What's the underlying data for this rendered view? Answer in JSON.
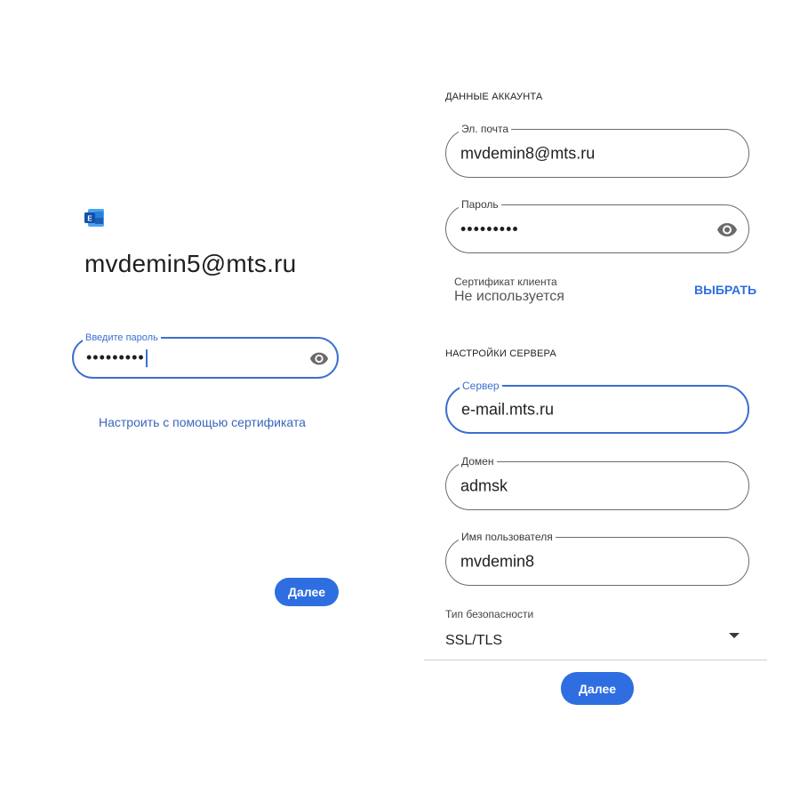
{
  "left": {
    "account_email": "mvdemin5@mts.ru",
    "password_field": {
      "label": "Введите пароль",
      "masked_value": "•••••••••"
    },
    "certificate_link": "Настроить с помощью сертификата",
    "next_button": "Далее"
  },
  "right": {
    "account_section": "ДАННЫЕ АККАУНТА",
    "email_field": {
      "label": "Эл. почта",
      "value": "mvdemin8@mts.ru"
    },
    "password_field": {
      "label": "Пароль",
      "masked_value": "•••••••••"
    },
    "client_cert": {
      "label": "Сертификат клиента",
      "value": "Не используется",
      "action": "ВЫБРАТЬ"
    },
    "server_section": "НАСТРОЙКИ СЕРВЕРА",
    "server_field": {
      "label": "Сервер",
      "value": "e-mail.mts.ru"
    },
    "domain_field": {
      "label": "Домен",
      "value": "admsk"
    },
    "username_field": {
      "label": "Имя пользователя",
      "value": "mvdemin8"
    },
    "security_type": {
      "label": "Тип безопасности",
      "value": "SSL/TLS"
    },
    "next_button": "Далее"
  },
  "colors": {
    "accent": "#2f6ee0",
    "focus_border": "#3c6fd0",
    "field_border": "#6b6b6b",
    "link": "#3a66b8",
    "outlook_logo": "#1e6fd0"
  },
  "icons": [
    "outlook-logo-icon",
    "eye-icon",
    "dropdown-arrow-icon"
  ]
}
